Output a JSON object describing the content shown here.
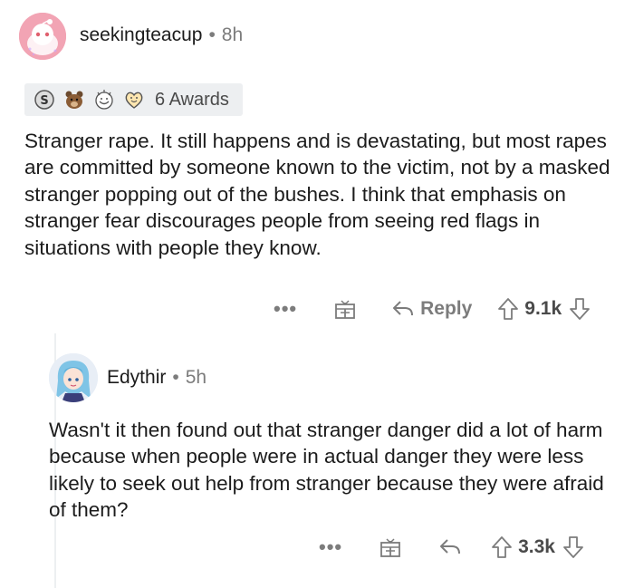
{
  "comment1": {
    "username": "seekingteacup",
    "separator": "•",
    "time": "8h",
    "awards_label": "6 Awards",
    "awards": [
      "silver-award-icon",
      "bear-award-icon",
      "wholesome-award-icon",
      "heart-award-icon"
    ],
    "body": "Stranger rape. It still happens and is devastating, but most rapes are committed by someone known to the victim, not by a masked stranger popping out of the bushes. I think that emphasis on stranger fear discourages people from seeing red flags in situations with people they know.",
    "actions": {
      "more": "•••",
      "reply_label": "Reply",
      "votes": "9.1k"
    }
  },
  "comment2": {
    "username": "Edythir",
    "separator": "•",
    "time": "5h",
    "body": "Wasn't it then found out that stranger danger did a lot of harm because when people were in actual danger they were less likely to seek out help from stranger because they were afraid of them?",
    "actions": {
      "more": "•••",
      "votes": "3.3k"
    }
  },
  "colors": {
    "text": "#1c1c1c",
    "meta": "#7c7c7c",
    "avatar1_bg": "#f2a4b4",
    "awards_bg": "#edeff1"
  }
}
